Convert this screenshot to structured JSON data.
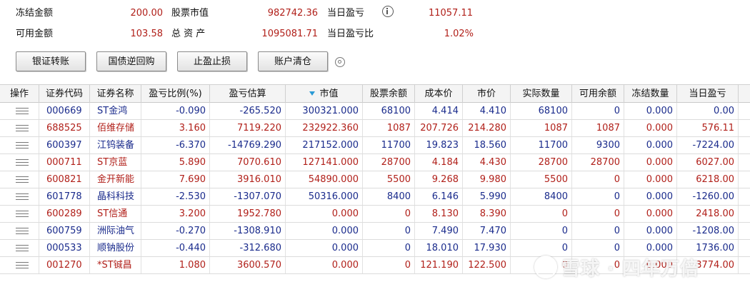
{
  "summary": {
    "frozen_amount_label": "冻结金额",
    "frozen_amount": "200.00",
    "market_value_label": "股票市值",
    "market_value": "982742.36",
    "day_pnl_label": "当日盈亏",
    "day_pnl": "11057.11",
    "available_amount_label": "可用金额",
    "available_amount": "103.58",
    "total_assets_label": "总 资 产",
    "total_assets": "1095081.71",
    "day_pnl_ratio_label": "当日盈亏比",
    "day_pnl_ratio": "1.02%"
  },
  "toolbar": {
    "bank_transfer": "银证转账",
    "reverse_repo": "国债逆回购",
    "stop_profit_loss": "止盈止损",
    "clear_account": "账户清仓"
  },
  "table": {
    "headers": [
      "操作",
      "证券代码",
      "证券名称",
      "盈亏比例(%)",
      "盈亏估算",
      "市值",
      "股票余额",
      "成本价",
      "市价",
      "实际数量",
      "可用余额",
      "冻结数量",
      "当日盈亏"
    ],
    "rows": [
      {
        "code": "000669",
        "name": "ST金鸿",
        "pnl_ratio": "-0.090",
        "pnl_est": "-265.520",
        "mkt_value": "300321.000",
        "balance": "68100",
        "cost": "4.414",
        "price": "4.410",
        "actual_qty": "68100",
        "available": "0",
        "frozen": "0.000",
        "day_pnl": "0.00",
        "tone": "blue"
      },
      {
        "code": "688525",
        "name": "佰维存储",
        "pnl_ratio": "3.160",
        "pnl_est": "7119.220",
        "mkt_value": "232922.360",
        "balance": "1087",
        "cost": "207.726",
        "price": "214.280",
        "actual_qty": "1087",
        "available": "1087",
        "frozen": "0.000",
        "day_pnl": "576.11",
        "tone": "red"
      },
      {
        "code": "600397",
        "name": "江钨装备",
        "pnl_ratio": "-6.370",
        "pnl_est": "-14769.290",
        "mkt_value": "217152.000",
        "balance": "11700",
        "cost": "19.823",
        "price": "18.560",
        "actual_qty": "11700",
        "available": "9300",
        "frozen": "0.000",
        "day_pnl": "-7224.00",
        "tone": "blue"
      },
      {
        "code": "000711",
        "name": "ST京蓝",
        "pnl_ratio": "5.890",
        "pnl_est": "7070.610",
        "mkt_value": "127141.000",
        "balance": "28700",
        "cost": "4.184",
        "price": "4.430",
        "actual_qty": "28700",
        "available": "28700",
        "frozen": "0.000",
        "day_pnl": "6027.00",
        "tone": "red"
      },
      {
        "code": "600821",
        "name": "金开新能",
        "pnl_ratio": "7.690",
        "pnl_est": "3916.010",
        "mkt_value": "54890.000",
        "balance": "5500",
        "cost": "9.268",
        "price": "9.980",
        "actual_qty": "5500",
        "available": "0",
        "frozen": "0.000",
        "day_pnl": "6218.00",
        "tone": "red"
      },
      {
        "code": "601778",
        "name": "晶科科技",
        "pnl_ratio": "-2.530",
        "pnl_est": "-1307.070",
        "mkt_value": "50316.000",
        "balance": "8400",
        "cost": "6.146",
        "price": "5.990",
        "actual_qty": "8400",
        "available": "0",
        "frozen": "0.000",
        "day_pnl": "-1260.00",
        "tone": "blue"
      },
      {
        "code": "600289",
        "name": "ST信通",
        "pnl_ratio": "3.200",
        "pnl_est": "1952.780",
        "mkt_value": "0.000",
        "balance": "0",
        "cost": "8.130",
        "price": "8.390",
        "actual_qty": "0",
        "available": "0",
        "frozen": "0.000",
        "day_pnl": "2418.00",
        "tone": "red"
      },
      {
        "code": "600759",
        "name": "洲际油气",
        "pnl_ratio": "-0.270",
        "pnl_est": "-1308.910",
        "mkt_value": "0.000",
        "balance": "0",
        "cost": "7.490",
        "price": "7.470",
        "actual_qty": "0",
        "available": "0",
        "frozen": "0.000",
        "day_pnl": "-1208.00",
        "tone": "blue"
      },
      {
        "code": "000533",
        "name": "顺钠股份",
        "pnl_ratio": "-0.440",
        "pnl_est": "-312.680",
        "mkt_value": "0.000",
        "balance": "0",
        "cost": "18.010",
        "price": "17.930",
        "actual_qty": "0",
        "available": "0",
        "frozen": "0.000",
        "day_pnl": "1736.00",
        "tone": "blue"
      },
      {
        "code": "001270",
        "name": "*ST铖昌",
        "pnl_ratio": "1.080",
        "pnl_est": "3600.570",
        "mkt_value": "0.000",
        "balance": "0",
        "cost": "121.190",
        "price": "122.500",
        "actual_qty": "0",
        "available": "0",
        "frozen": "0.000",
        "day_pnl": "3774.00",
        "tone": "red"
      }
    ]
  },
  "icons": {
    "info": "info-icon",
    "settings": "gear-icon",
    "row_menu": "menu-icon"
  },
  "watermark": "雪球 · 四年万倍",
  "colors": {
    "positive": "#b1201a",
    "negative": "#1a2b8c",
    "sort_indicator": "#2a9bd6"
  }
}
